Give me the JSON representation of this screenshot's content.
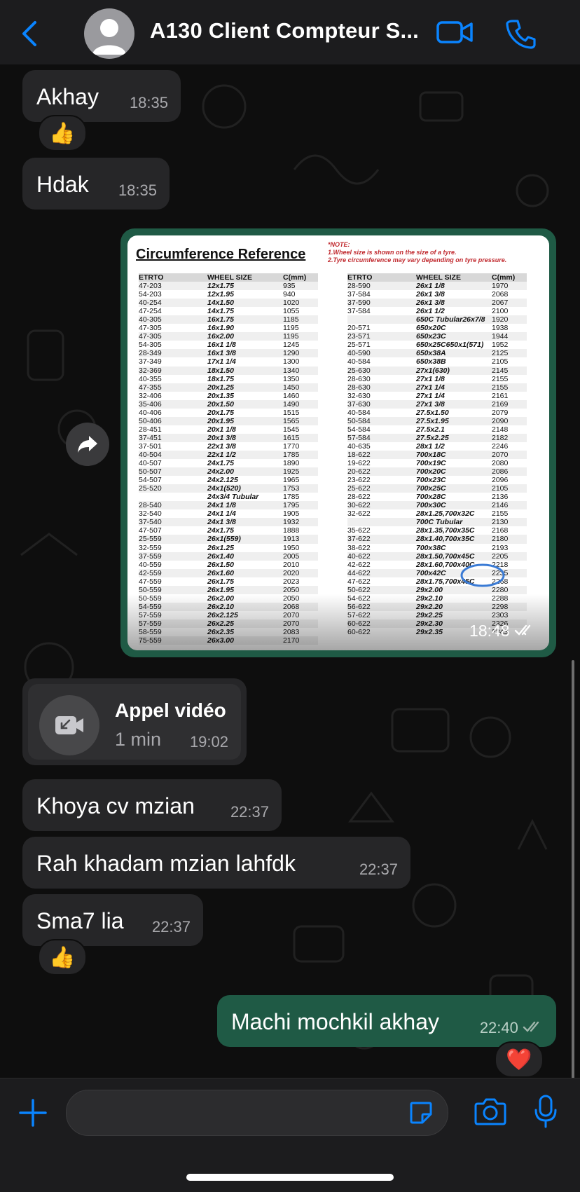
{
  "header": {
    "title": "A130 Client Compteur S...",
    "back_icon": "chevron-left-icon",
    "video_icon": "video-camera-icon",
    "phone_icon": "phone-icon",
    "accent": "#0a84ff"
  },
  "messages": [
    {
      "text": "Akhay",
      "time": "18:35",
      "direction": "incoming",
      "reaction": "👍"
    },
    {
      "text": "Hdak",
      "time": "18:35",
      "direction": "incoming"
    },
    {
      "text": "Khoya cv mzian",
      "time": "22:37",
      "direction": "incoming"
    },
    {
      "text": "Rah khadam mzian lahfdk",
      "time": "22:37",
      "direction": "incoming"
    },
    {
      "text": "Sma7 lia",
      "time": "22:37",
      "direction": "incoming",
      "reaction": "👍"
    },
    {
      "text": "Machi mochkil akhay",
      "time": "22:40",
      "direction": "outgoing",
      "reaction": "❤️"
    }
  ],
  "image_message": {
    "time": "18:48",
    "status_icon": "double-check-icon",
    "forward_icon": "forward-icon",
    "title": "Circumference Reference",
    "note_title": "*NOTE:",
    "note_1": "1.Wheel size is shown on the size of a tyre.",
    "note_2": "2.Tyre circumference may vary depending on tyre pressure.",
    "headers": [
      "ETRTO",
      "WHEEL SIZE",
      "C(mm)"
    ],
    "left_rows": [
      [
        "47-203",
        "12x1.75",
        "935"
      ],
      [
        "54-203",
        "12x1.95",
        "940"
      ],
      [
        "40-254",
        "14x1.50",
        "1020"
      ],
      [
        "47-254",
        "14x1.75",
        "1055"
      ],
      [
        "40-305",
        "16x1.75",
        "1185"
      ],
      [
        "47-305",
        "16x1.90",
        "1195"
      ],
      [
        "47-305",
        "16x2.00",
        "1195"
      ],
      [
        "54-305",
        "16x1 1/8",
        "1245"
      ],
      [
        "28-349",
        "16x1 3/8",
        "1290"
      ],
      [
        "37-349",
        "17x1 1/4",
        "1300"
      ],
      [
        "32-369",
        "18x1.50",
        "1340"
      ],
      [
        "40-355",
        "18x1.75",
        "1350"
      ],
      [
        "47-355",
        "20x1.25",
        "1450"
      ],
      [
        "32-406",
        "20x1.35",
        "1460"
      ],
      [
        "35-406",
        "20x1.50",
        "1490"
      ],
      [
        "40-406",
        "20x1.75",
        "1515"
      ],
      [
        "50-406",
        "20x1.95",
        "1565"
      ],
      [
        "28-451",
        "20x1 1/8",
        "1545"
      ],
      [
        "37-451",
        "20x1 3/8",
        "1615"
      ],
      [
        "37-501",
        "22x1 3/8",
        "1770"
      ],
      [
        "40-504",
        "22x1 1/2",
        "1785"
      ],
      [
        "40-507",
        "24x1.75",
        "1890"
      ],
      [
        "50-507",
        "24x2.00",
        "1925"
      ],
      [
        "54-507",
        "24x2.125",
        "1965"
      ],
      [
        "25-520",
        "24x1(520)",
        "1753"
      ],
      [
        "",
        "24x3/4 Tubular",
        "1785"
      ],
      [
        "28-540",
        "24x1 1/8",
        "1795"
      ],
      [
        "32-540",
        "24x1 1/4",
        "1905"
      ],
      [
        "37-540",
        "24x1 3/8",
        "1932"
      ],
      [
        "47-507",
        "24x1.75",
        "1888"
      ],
      [
        "25-559",
        "26x1(559)",
        "1913"
      ],
      [
        "32-559",
        "26x1.25",
        "1950"
      ],
      [
        "37-559",
        "26x1.40",
        "2005"
      ],
      [
        "40-559",
        "26x1.50",
        "2010"
      ],
      [
        "42-559",
        "26x1.60",
        "2020"
      ],
      [
        "47-559",
        "26x1.75",
        "2023"
      ],
      [
        "50-559",
        "26x1.95",
        "2050"
      ],
      [
        "50-559",
        "26x2.00",
        "2050"
      ],
      [
        "54-559",
        "26x2.10",
        "2068"
      ],
      [
        "57-559",
        "26x2.125",
        "2070"
      ],
      [
        "57-559",
        "26x2.25",
        "2070"
      ],
      [
        "58-559",
        "26x2.35",
        "2083"
      ],
      [
        "75-559",
        "26x3.00",
        "2170"
      ]
    ],
    "right_rows": [
      [
        "28-590",
        "26x1 1/8",
        "1970"
      ],
      [
        "37-584",
        "26x1 3/8",
        "2068"
      ],
      [
        "37-590",
        "26x1 3/8",
        "2067"
      ],
      [
        "37-584",
        "26x1 1/2",
        "2100"
      ],
      [
        "",
        "650C Tubular26x7/8",
        "1920"
      ],
      [
        "20-571",
        "650x20C",
        "1938"
      ],
      [
        "23-571",
        "650x23C",
        "1944"
      ],
      [
        "25-571",
        "650x25C650x1(571)",
        "1952"
      ],
      [
        "40-590",
        "650x38A",
        "2125"
      ],
      [
        "40-584",
        "650x38B",
        "2105"
      ],
      [
        "25-630",
        "27x1(630)",
        "2145"
      ],
      [
        "28-630",
        "27x1 1/8",
        "2155"
      ],
      [
        "28-630",
        "27x1 1/4",
        "2155"
      ],
      [
        "32-630",
        "27x1 1/4",
        "2161"
      ],
      [
        "37-630",
        "27x1 3/8",
        "2169"
      ],
      [
        "40-584",
        "27.5x1.50",
        "2079"
      ],
      [
        "50-584",
        "27.5x1.95",
        "2090"
      ],
      [
        "54-584",
        "27.5x2.1",
        "2148"
      ],
      [
        "57-584",
        "27.5x2.25",
        "2182"
      ],
      [
        "40-635",
        "28x1 1/2",
        "2246"
      ],
      [
        "18-622",
        "700x18C",
        "2070"
      ],
      [
        "19-622",
        "700x19C",
        "2080"
      ],
      [
        "20-622",
        "700x20C",
        "2086"
      ],
      [
        "23-622",
        "700x23C",
        "2096"
      ],
      [
        "25-622",
        "700x25C",
        "2105"
      ],
      [
        "28-622",
        "700x28C",
        "2136"
      ],
      [
        "30-622",
        "700x30C",
        "2146"
      ],
      [
        "32-622",
        "28x1.25,700x32C",
        "2155"
      ],
      [
        "",
        "700C Tubular",
        "2130"
      ],
      [
        "35-622",
        "28x1.35,700x35C",
        "2168"
      ],
      [
        "37-622",
        "28x1.40,700x35C",
        "2180"
      ],
      [
        "38-622",
        "700x38C",
        "2193"
      ],
      [
        "40-622",
        "28x1.50,700x45C",
        "2205"
      ],
      [
        "42-622",
        "28x1.60,700x40C",
        "2218"
      ],
      [
        "44-622",
        "700x42C",
        "2235"
      ],
      [
        "47-622",
        "28x1.75,700x45C",
        "2268"
      ],
      [
        "50-622",
        "29x2.00",
        "2280"
      ],
      [
        "54-622",
        "29x2.10",
        "2288"
      ],
      [
        "56-622",
        "29x2.20",
        "2298"
      ],
      [
        "57-622",
        "29x2.25",
        "2303"
      ],
      [
        "60-622",
        "29x2.30",
        "2326"
      ],
      [
        "60-622",
        "29x2.35",
        "2343"
      ]
    ]
  },
  "call": {
    "title": "Appel vidéo",
    "duration": "1 min",
    "time": "19:02",
    "icon": "missed-video-call-icon"
  },
  "composer": {
    "plus_icon": "plus-icon",
    "sticker_icon": "sticker-icon",
    "camera_icon": "camera-icon",
    "mic_icon": "microphone-icon"
  }
}
